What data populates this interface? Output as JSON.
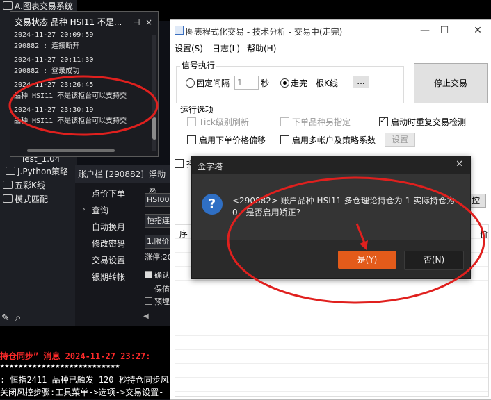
{
  "tree": {
    "items": [
      "A.图表交易系统",
      "J.Python策略",
      "五彩K线",
      "模式匹配",
      "Test_1.04"
    ]
  },
  "log_window": {
    "title": "交易状态 品种 HSI11 不是...",
    "pin_icon": "pin-icon",
    "entries": [
      {
        "time": "2024-11-27 20:09:59",
        "text": "290882 : 连接断开"
      },
      {
        "time": "2024-11-27 20:11:30",
        "text": "290882 : 登录成功"
      },
      {
        "time": "2024-11-27 23:26:45",
        "text": "品种 HSI11 不是该柜台可以支持交"
      },
      {
        "time": "2024-11-27 23:30:19",
        "text": "品种 HSI11 不是该柜台可以支持交"
      }
    ]
  },
  "account": {
    "title": "账户栏 [290882]",
    "tab2": "浮动盈",
    "menu": [
      "点价下单",
      "查询",
      "自动换月",
      "修改密码",
      "交易设置",
      "银期转帐"
    ],
    "fields": [
      "HSI00",
      "恒指连",
      "1.限价",
      "涨停:20"
    ],
    "checks": [
      "确认",
      "保值",
      "预埋"
    ]
  },
  "bottom_log": {
    "line1": "持仓同步” 消息 2024-11-27 23:27:",
    "line2": "★★★★★★★★★★★★★★★★★★★★★★★★★★",
    "line3": ": 恒指2411 品种已触发 120 秒持仓同步风",
    "line4": "关闭风控步骤:工具菜单->选项->交易设置-"
  },
  "main_window": {
    "title": "图表程式化交易 - 技术分析 - 交易中(走完)",
    "menus": [
      "设置(S)",
      "日志(L)",
      "帮助(H)"
    ],
    "signal_group": "信号执行",
    "radio_fixed": "固定间隔",
    "interval_value": "1",
    "interval_unit": "秒",
    "radio_bar": "走完一根K线",
    "ellipsis": "...",
    "stop_button": "停止交易",
    "run_group": "运行选项",
    "opt_tick": "Tick级别刷新",
    "opt_next": "下单品种另指定",
    "opt_recheck": "启动时重复交易检测",
    "opt_offset": "启用下单价格偏移",
    "opt_multi": "启用多帐户及策略系数",
    "settings_button": "设置",
    "partial_label": "持",
    "partial_btn": "控",
    "grid_col1": "序",
    "grid_col_right": "价"
  },
  "dialog": {
    "title": "金字塔",
    "message": "<290882> 账户品种 HSI11 多仓理论持仓为 1 实际持仓为 0，是否启用矫正?",
    "yes": "是(Y)",
    "no": "否(N)"
  },
  "colors": {
    "accent": "#e35b1a",
    "annotation_red": "#e0201e",
    "dialog_bg": "#343434"
  }
}
